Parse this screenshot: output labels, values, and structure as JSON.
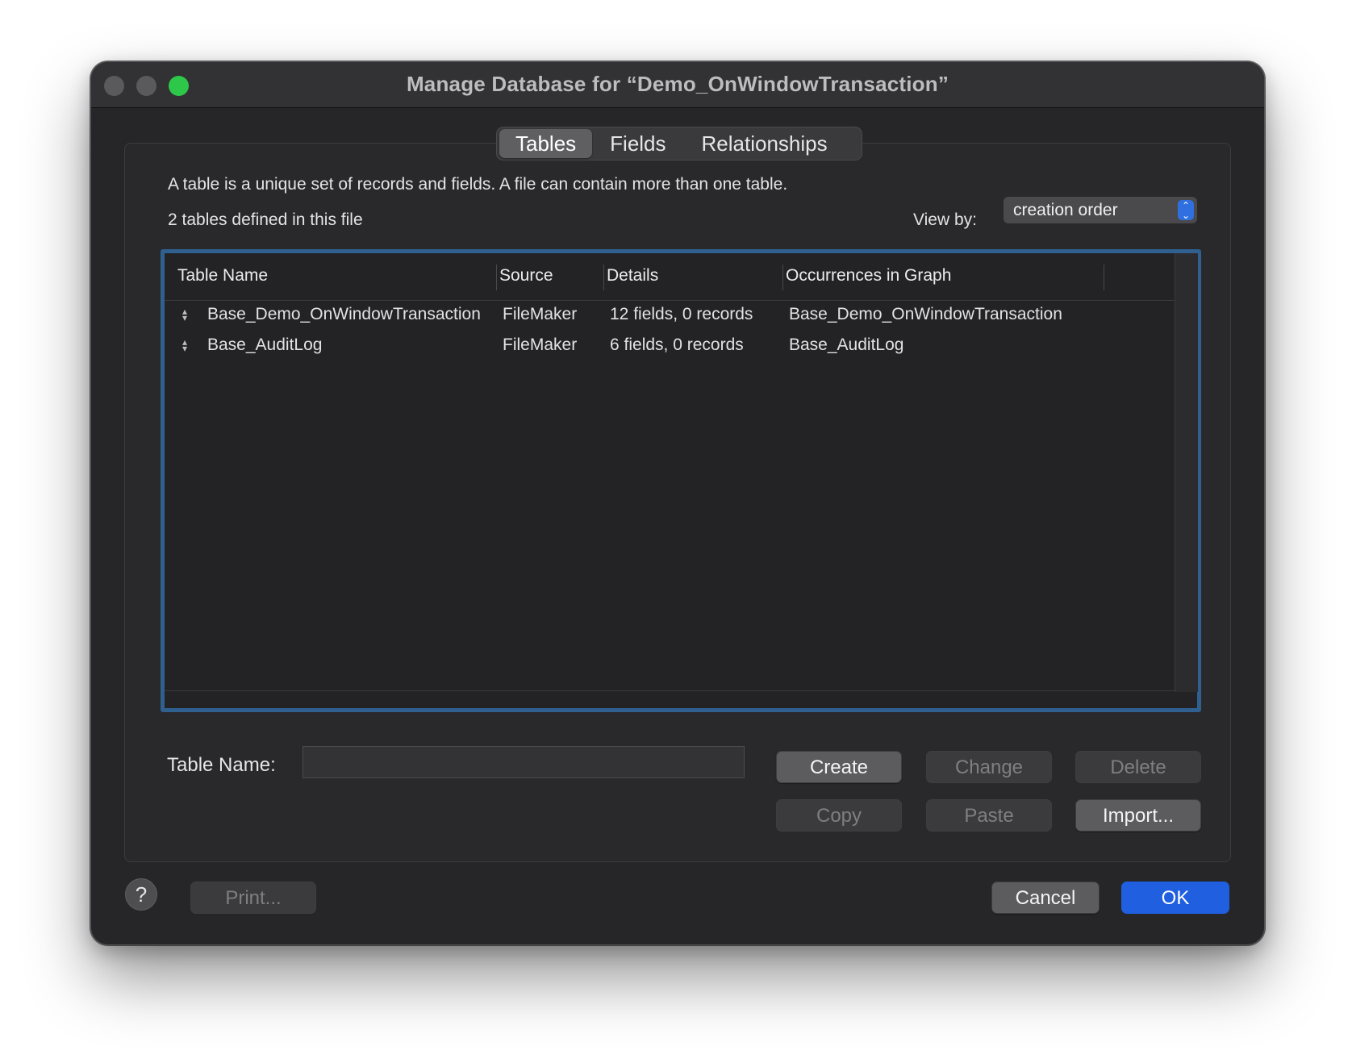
{
  "window": {
    "title": "Manage Database for “Demo_OnWindowTransaction”"
  },
  "tabs": [
    {
      "label": "Tables",
      "active": true
    },
    {
      "label": "Fields",
      "active": false
    },
    {
      "label": "Relationships",
      "active": false
    }
  ],
  "description": "A table is a unique set of records and fields. A file can contain more than one table.",
  "table_count_text": "2 tables defined in this file",
  "view_by": {
    "label": "View by:",
    "selected": "creation order"
  },
  "table_list": {
    "columns": [
      "Table Name",
      "Source",
      "Details",
      "Occurrences in Graph"
    ],
    "rows": [
      {
        "name": "Base_Demo_OnWindowTransaction",
        "source": "FileMaker",
        "details": "12 fields, 0 records",
        "occurrences": "Base_Demo_OnWindowTransaction"
      },
      {
        "name": "Base_AuditLog",
        "source": "FileMaker",
        "details": "6 fields, 0 records",
        "occurrences": "Base_AuditLog"
      }
    ]
  },
  "table_name_field": {
    "label": "Table Name:",
    "value": ""
  },
  "buttons": {
    "create": "Create",
    "change": "Change",
    "delete": "Delete",
    "copy": "Copy",
    "paste": "Paste",
    "import": "Import...",
    "print": "Print...",
    "cancel": "Cancel",
    "ok": "OK",
    "help": "?"
  },
  "colors": {
    "accent": "#1f5fe0",
    "selection_border": "#30608f",
    "zoom_button": "#2dc84a"
  }
}
